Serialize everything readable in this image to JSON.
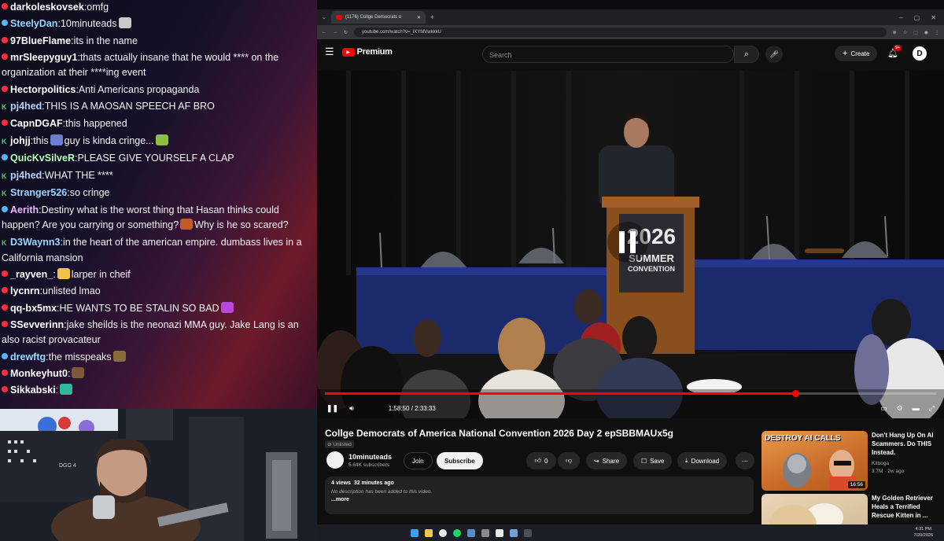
{
  "chat": {
    "messages": [
      {
        "user": "darkoleskovsek",
        "text": "omfg",
        "badge": "red",
        "color": "#ffffff"
      },
      {
        "user": "SteelyDan",
        "text": "10minuteads",
        "badge": "blue",
        "color": "#9ad7ff",
        "emote": "#c9c9c9"
      },
      {
        "user": "97BlueFlame",
        "text": "its in the name",
        "badge": "red",
        "color": "#ffffff"
      },
      {
        "user": "mrSleepyguy1",
        "text": "thats actually insane that he would **** on the organization at their ****ing event",
        "badge": "red",
        "color": "#ffffff"
      },
      {
        "user": "Hectorpolitics",
        "text": "Anti Americans propaganda",
        "badge": "red",
        "color": "#ffffff"
      },
      {
        "user": "pj4hed",
        "text": "THIS IS A MAOSAN SPEECH AF BRO",
        "badge": "k",
        "color": "#b7d3ff"
      },
      {
        "user": "CapnDGAF",
        "text": "this happened",
        "badge": "red",
        "color": "#ffffff"
      },
      {
        "user": "johjj",
        "text": "this",
        "after": "guy is kinda cringe...",
        "badge": "k",
        "color": "#ffffff",
        "emote": "#6a7fd1",
        "emote2": "#8fbf3c"
      },
      {
        "user": "QuicKvSilveR",
        "text": "PLEASE GIVE YOURSELF A CLAP",
        "badge": "blue",
        "color": "#b7ffb7"
      },
      {
        "user": "pj4hed",
        "text": "WHAT THE ****",
        "badge": "k",
        "color": "#b7d3ff"
      },
      {
        "user": "Stranger526",
        "text": "so cringe",
        "badge": "k",
        "color": "#9ad7ff"
      },
      {
        "user": "Aerith",
        "text": "Destiny what is the worst thing that Hasan thinks could happen? Are you carrying or something?",
        "after": "Why is he so scared?",
        "badge": "blue",
        "color": "#e8b9ff",
        "emote": "#c25a2a"
      },
      {
        "user": "D3Waynn3",
        "text": "in the heart of the american empire. dumbass lives in a California mansion",
        "badge": "k",
        "color": "#9ad7ff"
      },
      {
        "user": "_rayven_",
        "text": "",
        "after": "larper in cheif",
        "badge": "red",
        "color": "#ffffff",
        "emote": "#f0c24a"
      },
      {
        "user": "lycnrn",
        "text": "unlisted lmao",
        "badge": "red",
        "color": "#ffffff"
      },
      {
        "user": "qq-bx5mx",
        "text": "HE WANTS TO BE STALIN SO BAD",
        "badge": "red",
        "color": "#ffffff",
        "emote": "#b84ad8"
      },
      {
        "user": "SSevverinn",
        "text": "jake sheilds is the neonazi MMA guy. Jake Lang is an also racist provacateur",
        "badge": "red",
        "color": "#ffffff"
      },
      {
        "user": "drewftg",
        "text": "the misspeaks",
        "badge": "blue",
        "color": "#9ad7ff",
        "emote": "#8a6b3a"
      },
      {
        "user": "Monkeyhut0",
        "text": "",
        "badge": "red",
        "color": "#ffffff",
        "emote": "#7a5a3a"
      },
      {
        "user": "Sikkabski",
        "text": "",
        "badge": "red",
        "color": "#ffffff",
        "emote": "#2fb89a"
      }
    ]
  },
  "browser": {
    "tab_title": "(1176) Collge Democrats o",
    "url": "youtube.com/watch?v=_lXYMVwkkkU"
  },
  "youtube": {
    "brand": "Premium",
    "search_placeholder": "Search",
    "create_label": "Create",
    "notif_count": "9+",
    "time_current": "1:58:50",
    "time_total": "2:33:33",
    "progress": 0.77,
    "title": "Collge Democrats of America National Convention 2026 Day 2 epSBBMAUx5g",
    "visibility": "Unlisted",
    "channel": "10minuteads",
    "subscribers": "5.64K subscribers",
    "join_label": "Join",
    "subscribe_label": "Subscribe",
    "likes": "0",
    "share_label": "Share",
    "save_label": "Save",
    "download_label": "Download",
    "views": "4 views",
    "age": "32 minutes ago",
    "description": "No description has been added to this video.",
    "more_label": "...more"
  },
  "podium_sign": {
    "line1": "2026",
    "line2": "SUMMER",
    "line3": "CONVENTION"
  },
  "recommendations": [
    {
      "title": "Don't Hang Up On AI Scammers. Do THIS Instead.",
      "channel": "Kitboga",
      "meta": "3.7M · 2w ago",
      "duration": "16:56",
      "thumb_text": "DESTROY AI CALLS"
    },
    {
      "title": "My Golden Retriever Heals a Terrified Rescue Kitten in ...",
      "channel": "",
      "meta": "",
      "duration": "",
      "thumb_text": ""
    }
  ],
  "taskbar": {
    "time": "4:31 PM",
    "date": "7/20/2026"
  },
  "colors": {
    "yt_red": "#ff0000",
    "progress": "#ff0000",
    "twitch_chat_bg": "#141028"
  }
}
